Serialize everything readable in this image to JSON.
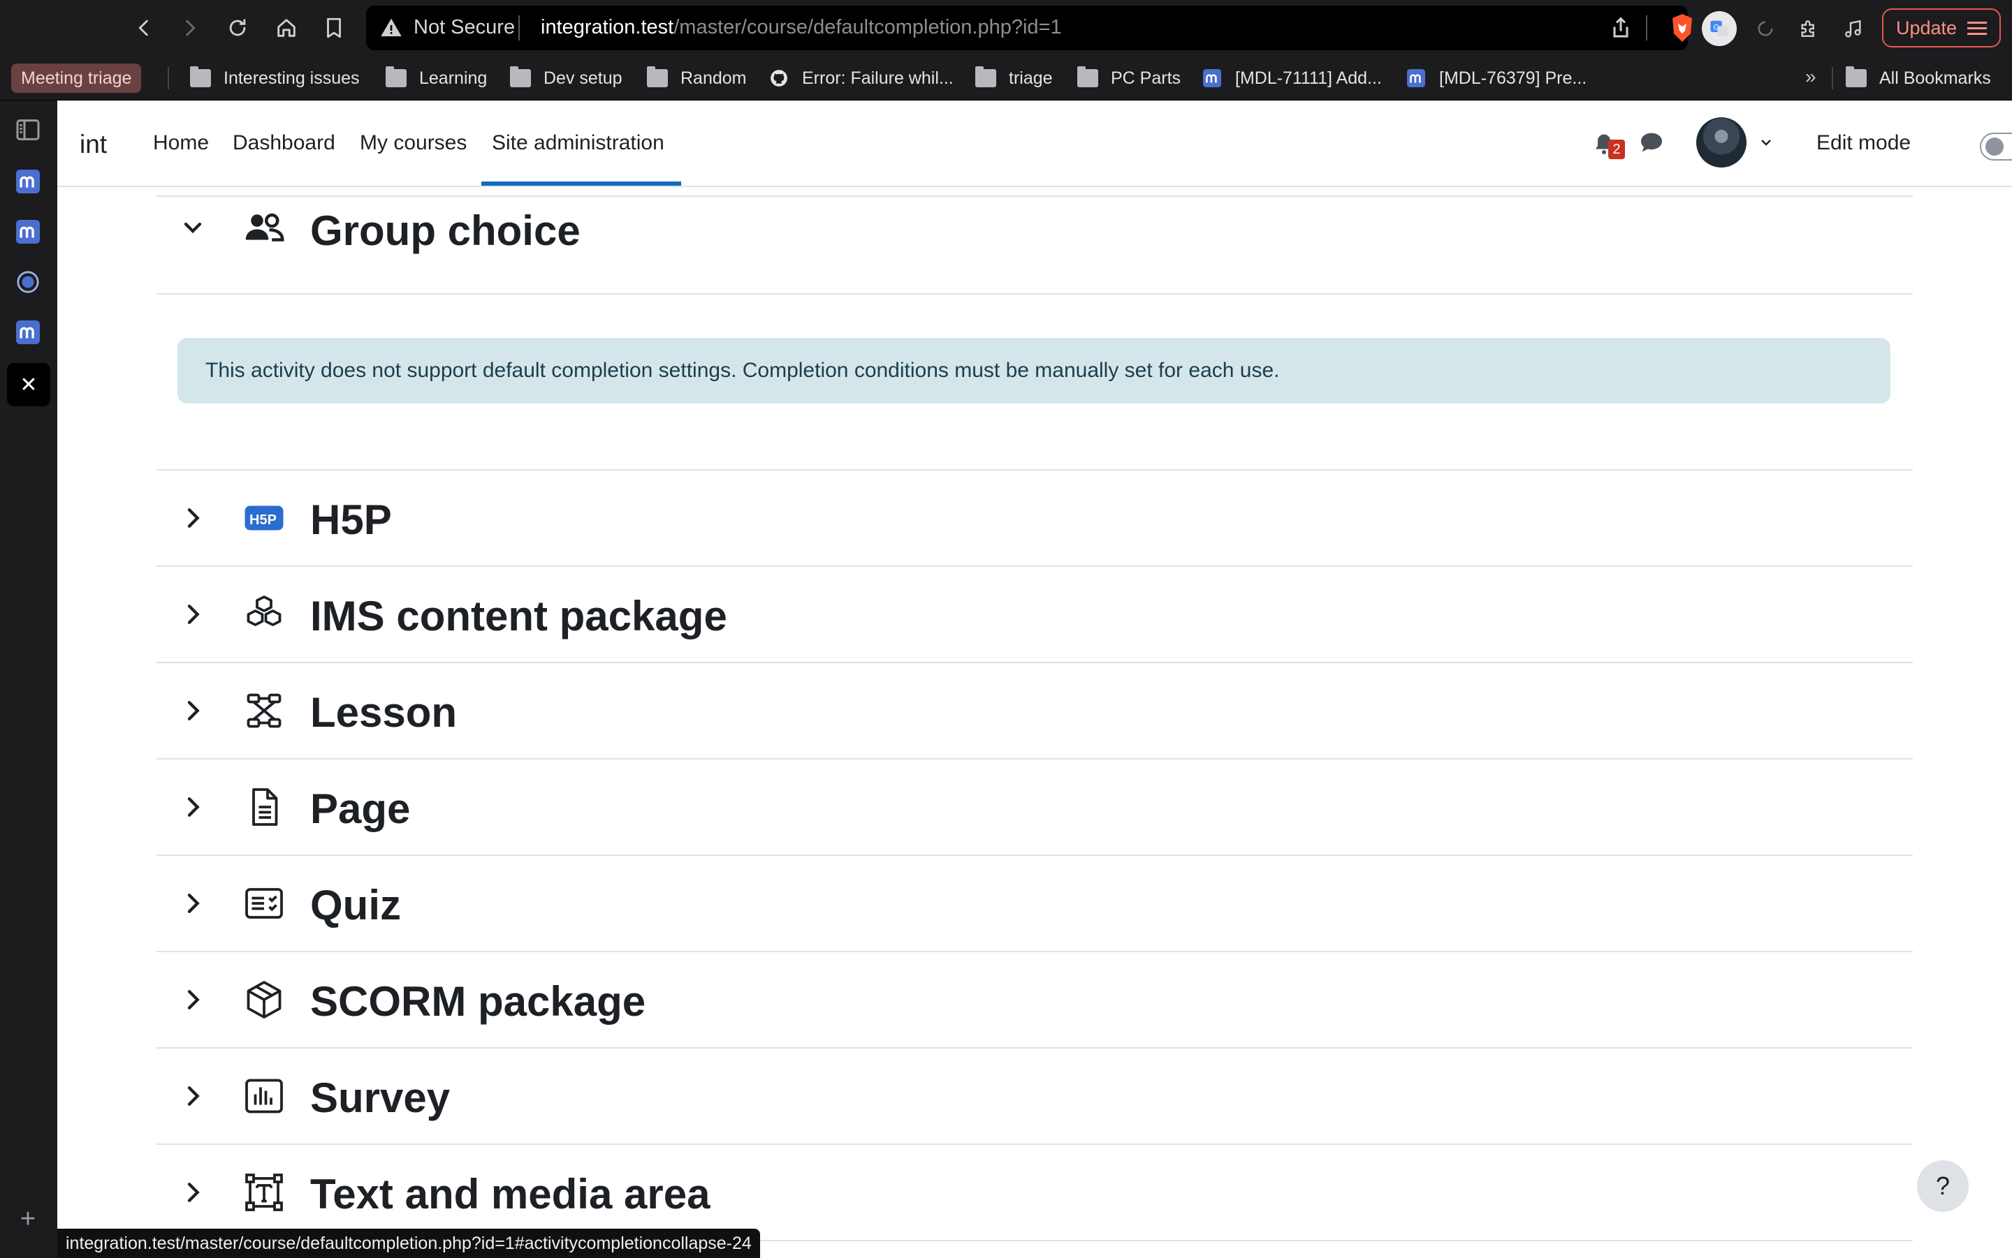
{
  "browser": {
    "url_security": "Not Secure",
    "url_host": "integration.test",
    "url_path": "/master/course/defaultcompletion.php?id=1",
    "update_label": "Update",
    "status_url": "integration.test/master/course/defaultcompletion.php?id=1#activitycompletioncollapse-24"
  },
  "bookmarks": {
    "highlighted": "Meeting triage",
    "items": [
      {
        "label": "Interesting issues",
        "icon": "folder-icon"
      },
      {
        "label": "Learning",
        "icon": "folder-icon"
      },
      {
        "label": "Dev setup",
        "icon": "folder-icon"
      },
      {
        "label": "Random",
        "icon": "folder-icon"
      },
      {
        "label": "Error: Failure whil...",
        "icon": "github-icon"
      },
      {
        "label": "triage",
        "icon": "folder-icon"
      },
      {
        "label": "PC Parts",
        "icon": "folder-icon"
      },
      {
        "label": "[MDL-71111] Add...",
        "icon": "moodle-icon"
      },
      {
        "label": "[MDL-76379] Pre...",
        "icon": "moodle-icon"
      }
    ],
    "overflow": "»",
    "all_bookmarks": "All Bookmarks"
  },
  "navbar": {
    "site_name": "int",
    "links": [
      "Home",
      "Dashboard",
      "My courses",
      "Site administration"
    ],
    "active_link": "Site administration",
    "notification_count": "2",
    "edit_mode_label": "Edit mode",
    "edit_mode_on": false
  },
  "content": {
    "expanded_section": {
      "title": "Group choice",
      "icon": "group-choice-icon",
      "alert": "This activity does not support default completion settings. Completion conditions must be manually set for each use."
    },
    "sections": [
      {
        "title": "H5P",
        "icon": "h5p-icon"
      },
      {
        "title": "IMS content package",
        "icon": "ims-package-icon"
      },
      {
        "title": "Lesson",
        "icon": "lesson-icon"
      },
      {
        "title": "Page",
        "icon": "page-icon"
      },
      {
        "title": "Quiz",
        "icon": "quiz-icon"
      },
      {
        "title": "SCORM package",
        "icon": "scorm-icon"
      },
      {
        "title": "Survey",
        "icon": "survey-icon"
      },
      {
        "title": "Text and media area",
        "icon": "text-media-icon"
      }
    ],
    "help_label": "?"
  },
  "colors": {
    "accent": "#0f6cbf",
    "alert_bg": "#d5e6eb",
    "notification_badge": "#ca3120",
    "update_border": "#e4574f"
  }
}
